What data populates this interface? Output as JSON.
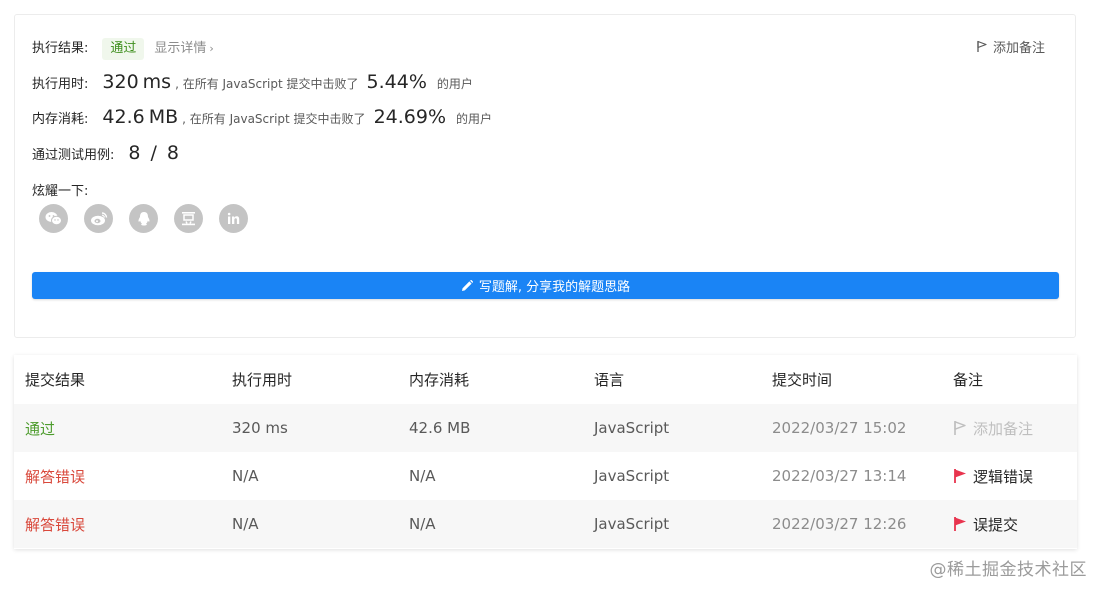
{
  "result": {
    "status_label": "执行结果:",
    "status_value": "通过",
    "details_link": "显示详情",
    "add_note": "添加备注",
    "runtime": {
      "label": "执行用时:",
      "value": "320",
      "unit": "ms",
      "mid_text": ", 在所有 JavaScript 提交中击败了",
      "percent": "5.44",
      "percent_sign": "%",
      "tail": "的用户"
    },
    "memory": {
      "label": "内存消耗:",
      "value": "42.6",
      "unit": "MB",
      "mid_text": ", 在所有 JavaScript 提交中击败了",
      "percent": "24.69",
      "percent_sign": "%",
      "tail": "的用户"
    },
    "testcases": {
      "label": "通过测试用例:",
      "passed": "8",
      "sep": "/",
      "total": "8"
    },
    "share_label": "炫耀一下:",
    "share_icons": [
      "wechat-icon",
      "weibo-icon",
      "qq-icon",
      "douban-icon",
      "linkedin-icon"
    ],
    "write_button": "写题解, 分享我的解题思路"
  },
  "table": {
    "headers": [
      "提交结果",
      "执行用时",
      "内存消耗",
      "语言",
      "提交时间",
      "备注"
    ],
    "rows": [
      {
        "result": "通过",
        "runtime": "320 ms",
        "memory": "42.6 MB",
        "language": "JavaScript",
        "time": "2022/03/27 15:02",
        "note": "添加备注"
      },
      {
        "result": "解答错误",
        "runtime": "N/A",
        "memory": "N/A",
        "language": "JavaScript",
        "time": "2022/03/27 13:14",
        "note": "逻辑错误"
      },
      {
        "result": "解答错误",
        "runtime": "N/A",
        "memory": "N/A",
        "language": "JavaScript",
        "time": "2022/03/27 12:26",
        "note": "误提交"
      }
    ]
  },
  "watermark": "@稀土掘金技术社区",
  "colors": {
    "accent": "#1a84f5",
    "pass": "#4d9c2d",
    "fail": "#d9483b",
    "flag_red": "#e8344e"
  }
}
